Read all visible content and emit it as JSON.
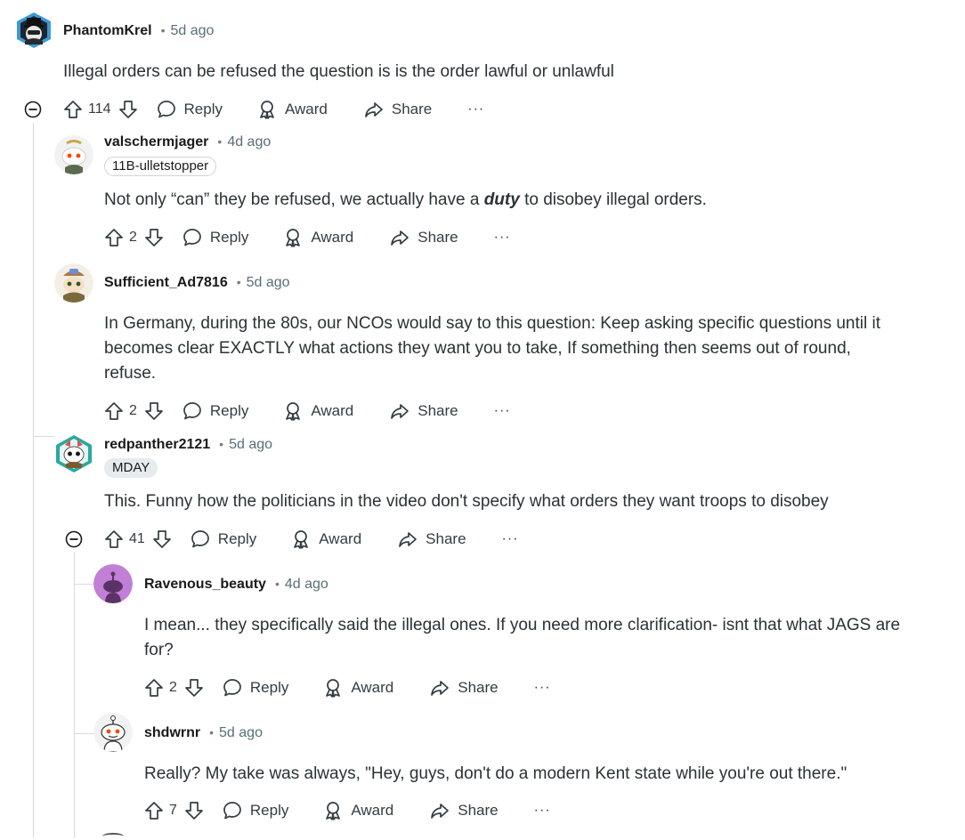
{
  "comments": [
    {
      "username": "PhantomKrel",
      "time": "5d ago",
      "flair": "",
      "body": [
        "Illegal orders can be refused the question is is the order lawful or unlawful"
      ],
      "votes": "114",
      "avatar_color": "#3a9ad9"
    },
    {
      "username": "valschermjager",
      "time": "4d ago",
      "flair": "11B-ulletstopper",
      "body_pre": "Not only “can” they be refused, we actually have a ",
      "body_em": "duty",
      "body_post": " to disobey illegal orders.",
      "votes": "2"
    },
    {
      "username": "Sufficient_Ad7816",
      "time": "5d ago",
      "flair": "",
      "body": [
        "In Germany, during the 80s, our NCOs would say to this question: Keep asking specific questions until it",
        "becomes clear EXACTLY what actions they want you to take, If something then seems out of round,",
        "refuse."
      ],
      "votes": "2"
    },
    {
      "username": "redpanther2121",
      "time": "5d ago",
      "flair": "MDAY",
      "body": [
        "This. Funny how the politicians in the video don't specify what orders they want troops to disobey"
      ],
      "votes": "41"
    },
    {
      "username": "Ravenous_beauty",
      "time": "4d ago",
      "flair": "",
      "body": [
        "I mean... they specifically said the illegal ones. If you need more clarification- isnt that what JAGS are",
        "for?"
      ],
      "votes": "2",
      "avatar_color": "#c27fd6"
    },
    {
      "username": "shdwrnr",
      "time": "5d ago",
      "flair": "",
      "body": [
        "Really? My take was always, \"Hey, guys, don't do a modern Kent state while you're out there.\""
      ],
      "votes": "7"
    }
  ],
  "actions": {
    "reply": "Reply",
    "award": "Award",
    "share": "Share",
    "more": "···"
  },
  "icons": {
    "upvote": "upvote-arrow-icon",
    "downvote": "downvote-arrow-icon",
    "reply": "speech-bubble-icon",
    "award": "award-ribbon-icon",
    "share": "share-arrow-icon",
    "collapse": "collapse-minus-icon"
  },
  "colors": {
    "text": "#1a1a1b",
    "meta": "#576f76",
    "thread_line": "#d7dadc"
  }
}
